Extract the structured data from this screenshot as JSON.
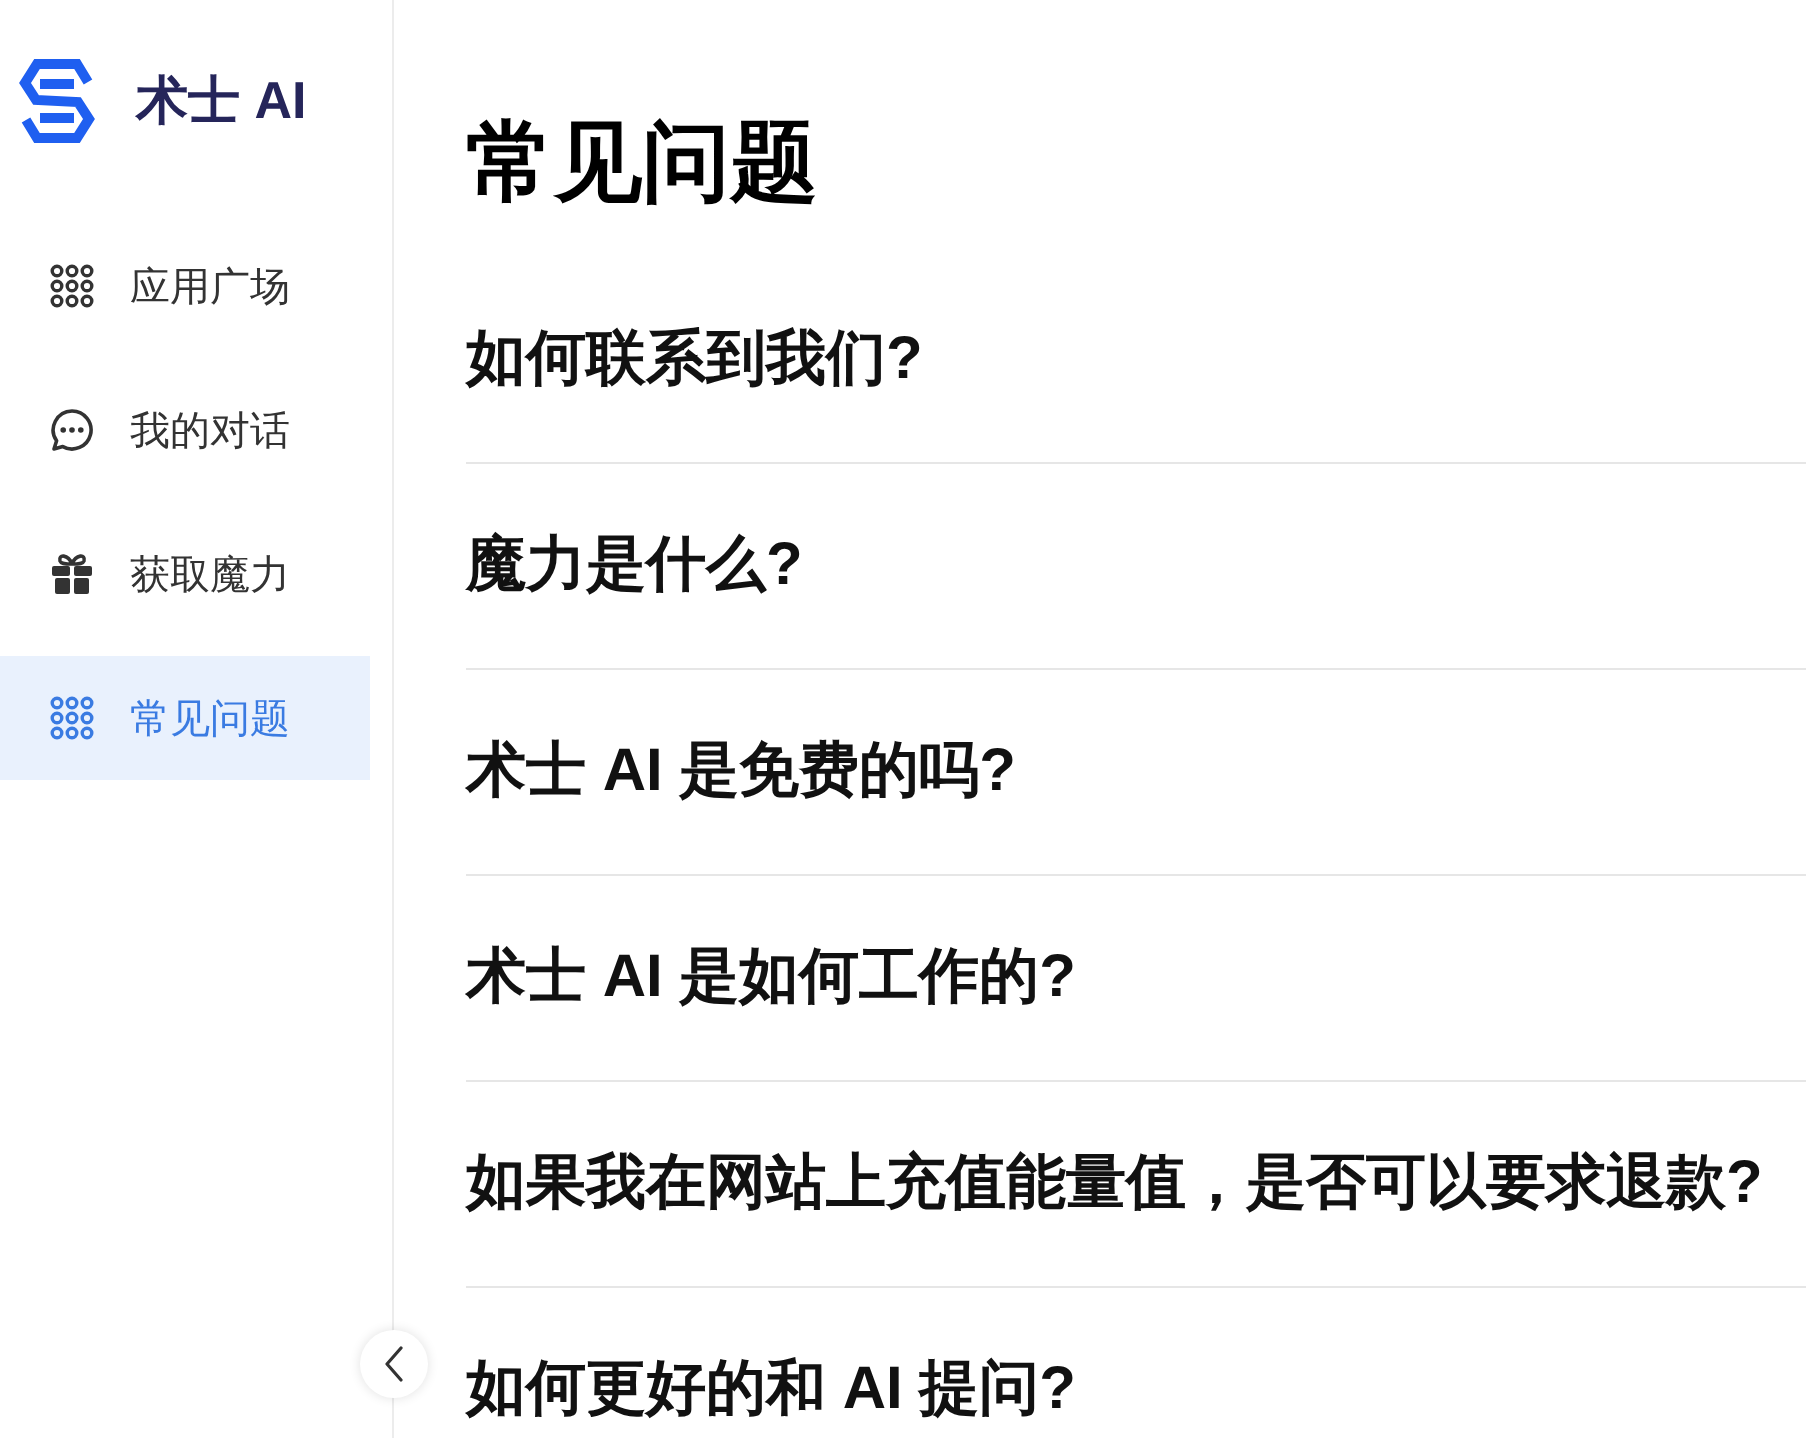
{
  "sidebar": {
    "brand": "术士 AI",
    "items": [
      {
        "kind": "grid",
        "label": "应用广场",
        "selected": false
      },
      {
        "kind": "chat",
        "label": "我的对话",
        "selected": false
      },
      {
        "kind": "gift",
        "label": "获取魔力",
        "selected": false
      },
      {
        "kind": "grid",
        "label": "常见问题",
        "selected": true
      }
    ]
  },
  "main": {
    "title": "常见问题",
    "faqs": [
      {
        "question": "如何联系到我们?"
      },
      {
        "question": "魔力是什么?"
      },
      {
        "question": "术士 AI 是免费的吗?"
      },
      {
        "question": "术士 AI 是如何工作的?"
      },
      {
        "question": "如果我在网站上充值能量值，是否可以要求退款?"
      },
      {
        "question": "如何更好的和 AI 提问?"
      }
    ]
  }
}
